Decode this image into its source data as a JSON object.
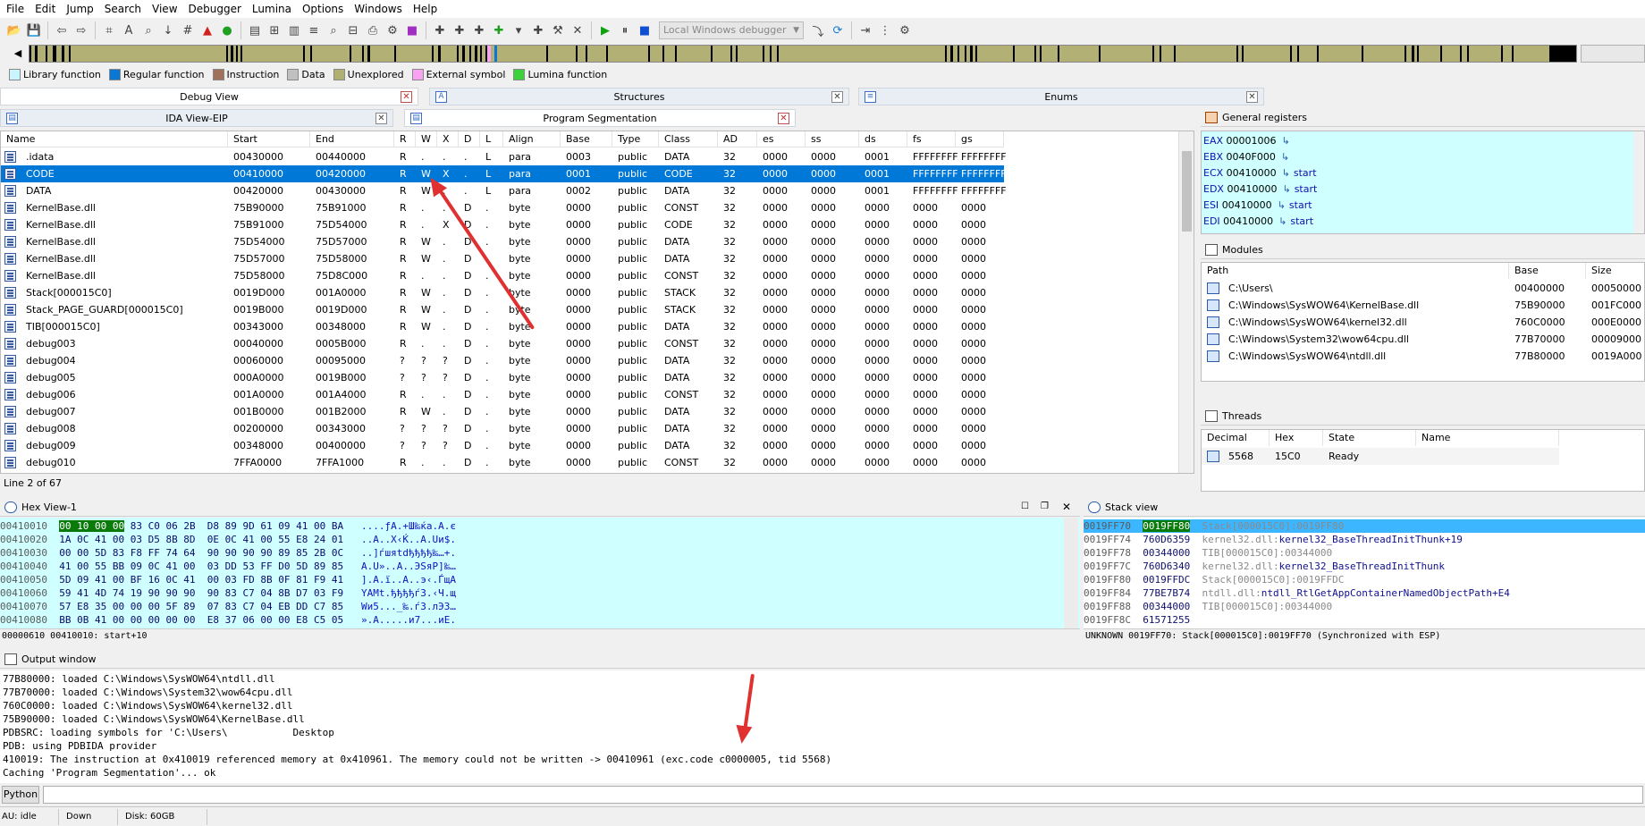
{
  "menu": [
    "File",
    "Edit",
    "Jump",
    "Search",
    "View",
    "Debugger",
    "Lumina",
    "Options",
    "Windows",
    "Help"
  ],
  "toolbar": {
    "debugger_select": "Local Windows debugger"
  },
  "legend": [
    {
      "label": "Library function",
      "color": "#c9f5ff"
    },
    {
      "label": "Regular function",
      "color": "#0a78d2"
    },
    {
      "label": "Instruction",
      "color": "#a0725a"
    },
    {
      "label": "Data",
      "color": "#c0c0c0"
    },
    {
      "label": "Unexplored",
      "color": "#b0b070"
    },
    {
      "label": "External symbol",
      "color": "#f7a3f2"
    },
    {
      "label": "Lumina function",
      "color": "#3cd23c"
    }
  ],
  "tabs_row1": {
    "debug_view": "Debug View",
    "structures": "Structures",
    "enums": "Enums"
  },
  "tabs_row2": {
    "ida_view": "IDA View-EIP",
    "program_segmentation": "Program Segmentation"
  },
  "segments": {
    "columns": [
      "Name",
      "Start",
      "End",
      "R",
      "W",
      "X",
      "D",
      "L",
      "Align",
      "Base",
      "Type",
      "Class",
      "AD",
      "es",
      "ss",
      "ds",
      "fs",
      "gs"
    ],
    "rows": [
      [
        ".idata",
        "00430000",
        "00440000",
        "R",
        ".",
        ".",
        ".",
        "L",
        "para",
        "0003",
        "public",
        "DATA",
        "32",
        "0000",
        "0000",
        "0001",
        "FFFFFFFF",
        "FFFFFFFF"
      ],
      [
        "CODE",
        "00410000",
        "00420000",
        "R",
        "W",
        "X",
        ".",
        "L",
        "para",
        "0001",
        "public",
        "CODE",
        "32",
        "0000",
        "0000",
        "0001",
        "FFFFFFFF",
        "FFFFFFFF"
      ],
      [
        "DATA",
        "00420000",
        "00430000",
        "R",
        "W",
        ".",
        ".",
        "L",
        "para",
        "0002",
        "public",
        "DATA",
        "32",
        "0000",
        "0000",
        "0001",
        "FFFFFFFF",
        "FFFFFFFF"
      ],
      [
        "KernelBase.dll",
        "75B90000",
        "75B91000",
        "R",
        ".",
        ".",
        "D",
        ".",
        "byte",
        "0000",
        "public",
        "CONST",
        "32",
        "0000",
        "0000",
        "0000",
        "0000",
        "0000"
      ],
      [
        "KernelBase.dll",
        "75B91000",
        "75D54000",
        "R",
        ".",
        "X",
        "D",
        ".",
        "byte",
        "0000",
        "public",
        "CODE",
        "32",
        "0000",
        "0000",
        "0000",
        "0000",
        "0000"
      ],
      [
        "KernelBase.dll",
        "75D54000",
        "75D57000",
        "R",
        "W",
        ".",
        "D",
        ".",
        "byte",
        "0000",
        "public",
        "DATA",
        "32",
        "0000",
        "0000",
        "0000",
        "0000",
        "0000"
      ],
      [
        "KernelBase.dll",
        "75D57000",
        "75D58000",
        "R",
        "W",
        ".",
        "D",
        ".",
        "byte",
        "0000",
        "public",
        "DATA",
        "32",
        "0000",
        "0000",
        "0000",
        "0000",
        "0000"
      ],
      [
        "KernelBase.dll",
        "75D58000",
        "75D8C000",
        "R",
        ".",
        ".",
        "D",
        ".",
        "byte",
        "0000",
        "public",
        "CONST",
        "32",
        "0000",
        "0000",
        "0000",
        "0000",
        "0000"
      ],
      [
        "Stack[000015C0]",
        "0019D000",
        "001A0000",
        "R",
        "W",
        ".",
        "D",
        ".",
        "byte",
        "0000",
        "public",
        "STACK",
        "32",
        "0000",
        "0000",
        "0000",
        "0000",
        "0000"
      ],
      [
        "Stack_PAGE_GUARD[000015C0]",
        "0019B000",
        "0019D000",
        "R",
        "W",
        ".",
        "D",
        ".",
        "byte",
        "0000",
        "public",
        "STACK",
        "32",
        "0000",
        "0000",
        "0000",
        "0000",
        "0000"
      ],
      [
        "TIB[000015C0]",
        "00343000",
        "00348000",
        "R",
        "W",
        ".",
        "D",
        ".",
        "byte",
        "0000",
        "public",
        "DATA",
        "32",
        "0000",
        "0000",
        "0000",
        "0000",
        "0000"
      ],
      [
        "debug003",
        "00040000",
        "0005B000",
        "R",
        ".",
        ".",
        "D",
        ".",
        "byte",
        "0000",
        "public",
        "CONST",
        "32",
        "0000",
        "0000",
        "0000",
        "0000",
        "0000"
      ],
      [
        "debug004",
        "00060000",
        "00095000",
        "?",
        "?",
        "?",
        "D",
        ".",
        "byte",
        "0000",
        "public",
        "DATA",
        "32",
        "0000",
        "0000",
        "0000",
        "0000",
        "0000"
      ],
      [
        "debug005",
        "000A0000",
        "0019B000",
        "?",
        "?",
        "?",
        "D",
        ".",
        "byte",
        "0000",
        "public",
        "DATA",
        "32",
        "0000",
        "0000",
        "0000",
        "0000",
        "0000"
      ],
      [
        "debug006",
        "001A0000",
        "001A4000",
        "R",
        ".",
        ".",
        "D",
        ".",
        "byte",
        "0000",
        "public",
        "CONST",
        "32",
        "0000",
        "0000",
        "0000",
        "0000",
        "0000"
      ],
      [
        "debug007",
        "001B0000",
        "001B2000",
        "R",
        "W",
        ".",
        "D",
        ".",
        "byte",
        "0000",
        "public",
        "DATA",
        "32",
        "0000",
        "0000",
        "0000",
        "0000",
        "0000"
      ],
      [
        "debug008",
        "00200000",
        "00343000",
        "?",
        "?",
        "?",
        "D",
        ".",
        "byte",
        "0000",
        "public",
        "DATA",
        "32",
        "0000",
        "0000",
        "0000",
        "0000",
        "0000"
      ],
      [
        "debug009",
        "00348000",
        "00400000",
        "?",
        "?",
        "?",
        "D",
        ".",
        "byte",
        "0000",
        "public",
        "DATA",
        "32",
        "0000",
        "0000",
        "0000",
        "0000",
        "0000"
      ],
      [
        "debug010",
        "7FFA0000",
        "7FFA1000",
        "R",
        ".",
        ".",
        "D",
        ".",
        "byte",
        "0000",
        "public",
        "CONST",
        "32",
        "0000",
        "0000",
        "0000",
        "0000",
        "0000"
      ]
    ],
    "status": "Line 2 of 67"
  },
  "registers": {
    "title": "General registers",
    "items": [
      {
        "name": "EAX",
        "value": "00001006",
        "label": ""
      },
      {
        "name": "EBX",
        "value": "0040F000",
        "label": ""
      },
      {
        "name": "ECX",
        "value": "00410000",
        "label": "start"
      },
      {
        "name": "EDX",
        "value": "00410000",
        "label": "start"
      },
      {
        "name": "ESI",
        "value": "00410000",
        "label": "start"
      },
      {
        "name": "EDI",
        "value": "00410000",
        "label": "start"
      }
    ]
  },
  "modules": {
    "title": "Modules",
    "columns": [
      "Path",
      "Base",
      "Size"
    ],
    "rows": [
      [
        "C:\\Users\\",
        "00400000",
        "00050000"
      ],
      [
        "C:\\Windows\\SysWOW64\\KernelBase.dll",
        "75B90000",
        "001FC000"
      ],
      [
        "C:\\Windows\\SysWOW64\\kernel32.dll",
        "760C0000",
        "000E0000"
      ],
      [
        "C:\\Windows\\System32\\wow64cpu.dll",
        "77B70000",
        "00009000"
      ],
      [
        "C:\\Windows\\SysWOW64\\ntdll.dll",
        "77B80000",
        "0019A000"
      ]
    ]
  },
  "threads": {
    "title": "Threads",
    "columns": [
      "Decimal",
      "Hex",
      "State",
      "Name"
    ],
    "rows": [
      [
        "5568",
        "15C0",
        "Ready",
        ""
      ]
    ]
  },
  "hex_view": {
    "title": "Hex View-1",
    "rows": [
      {
        "addr": "00410010",
        "hl": "00 10 00 00",
        "bytes": " 83 C0 06 2B  D8 89 9D 61 09 41 00 BA",
        "ascii": "....ƒА.+Ш‰ќa.A.є"
      },
      {
        "addr": "00410020",
        "hl": "",
        "bytes": "1A 0C 41 00 03 D5 8B 8D  0E 0C 41 00 55 E8 24 01",
        "ascii": "..A..Х‹Ќ..A.Uи$."
      },
      {
        "addr": "00410030",
        "hl": "",
        "bytes": "00 00 5D 83 F8 FF 74 64  90 90 90 90 89 85 2B 0C",
        "ascii": "..]ѓшяtdђђђђ‰…+."
      },
      {
        "addr": "00410040",
        "hl": "",
        "bytes": "41 00 55 BB 09 0C 41 00  03 DD 53 FF D0 5D 89 85",
        "ascii": "A.U»..A..ЭSяР]‰…"
      },
      {
        "addr": "00410050",
        "hl": "",
        "bytes": "5D 09 41 00 BF 16 0C 41  00 03 FD 8B 0F 81 F9 41",
        "ascii": "].A.ї..A..э‹.ЃщA"
      },
      {
        "addr": "00410060",
        "hl": "",
        "bytes": "59 41 4D 74 19 90 90 90  90 83 C7 04 8B D7 03 F9",
        "ascii": "YAMt.ђђђђѓЗ.‹Ч.щ"
      },
      {
        "addr": "00410070",
        "hl": "",
        "bytes": "57 E8 35 00 00 00 5F 89  07 83 C7 04 EB DD C7 85",
        "ascii": "Wи5..._‰.ѓЗ.лЭЗ…"
      },
      {
        "addr": "00410080",
        "hl": "",
        "bytes": "BB 0B 41 00 00 00 00 00  E8 37 06 00 00 E8 C5 05",
        "ascii": "».A.....и7...иЕ."
      }
    ],
    "status": "00000610 00410010: start+10"
  },
  "stack_view": {
    "title": "Stack view",
    "rows": [
      {
        "addr": "0019FF70",
        "val": "0019FF80",
        "comment": "Stack[000015C0]:0019FF80",
        "sym": "",
        "sel": true
      },
      {
        "addr": "0019FF74",
        "val": "760D6359",
        "comment": "kernel32.dll:",
        "sym": "kernel32_BaseThreadInitThunk+19",
        "sel": false
      },
      {
        "addr": "0019FF78",
        "val": "00344000",
        "comment": "TIB[000015C0]:00344000",
        "sym": "",
        "sel": false
      },
      {
        "addr": "0019FF7C",
        "val": "760D6340",
        "comment": "kernel32.dll:",
        "sym": "kernel32_BaseThreadInitThunk",
        "sel": false
      },
      {
        "addr": "0019FF80",
        "val": "0019FFDC",
        "comment": "Stack[000015C0]:0019FFDC",
        "sym": "",
        "sel": false
      },
      {
        "addr": "0019FF84",
        "val": "77BE7B74",
        "comment": "ntdll.dll:",
        "sym": "ntdll_RtlGetAppContainerNamedObjectPath+E4",
        "sel": false
      },
      {
        "addr": "0019FF88",
        "val": "00344000",
        "comment": "TIB[000015C0]:00344000",
        "sym": "",
        "sel": false
      },
      {
        "addr": "0019FF8C",
        "val": "61571255",
        "comment": "",
        "sym": "",
        "sel": false
      }
    ],
    "status": "UNKNOWN 0019FF70: Stack[000015C0]:0019FF70 (Synchronized with ESP)"
  },
  "output": {
    "title": "Output window",
    "lines": [
      "77B80000: loaded C:\\Windows\\SysWOW64\\ntdll.dll",
      "77B70000: loaded C:\\Windows\\System32\\wow64cpu.dll",
      "760C0000: loaded C:\\Windows\\SysWOW64\\kernel32.dll",
      "75B90000: loaded C:\\Windows\\SysWOW64\\KernelBase.dll",
      "PDBSRC: loading symbols for 'C:\\Users\\           Desktop",
      "PDB: using PDBIDA provider",
      "410019: The instruction at 0x410019 referenced memory at 0x410961. The memory could not be written -> 00410961 (exc.code c0000005, tid 5568)",
      "Caching 'Program Segmentation'... ok"
    ]
  },
  "python_button": "Python",
  "statusbar": {
    "state": "AU:  idle",
    "direction": "Down",
    "disk": "Disk: 60GB"
  }
}
